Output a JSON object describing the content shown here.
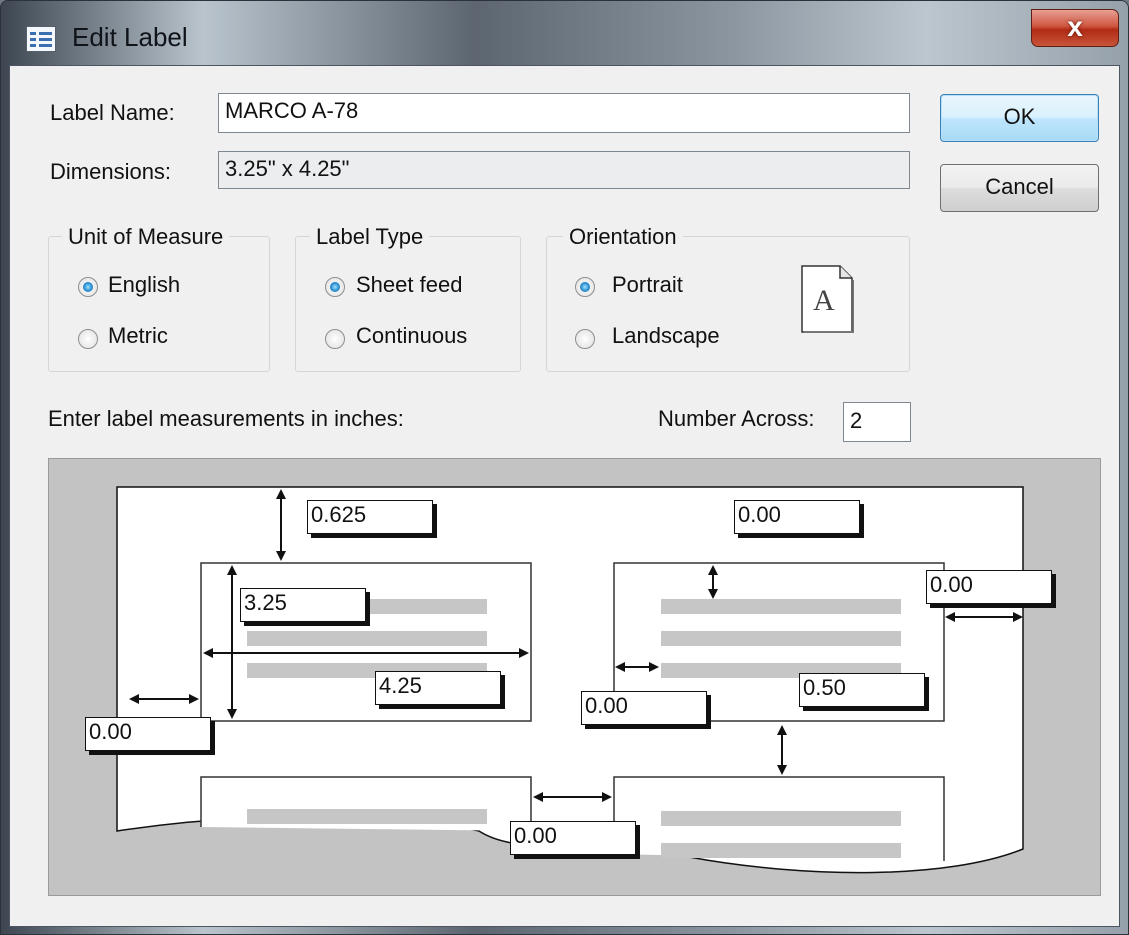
{
  "window": {
    "title": "Edit Label",
    "close_glyph": "x",
    "app_icon": "label-list-icon"
  },
  "form": {
    "label_name_label": "Label Name:",
    "label_name_value": "MARCO A-78",
    "dimensions_label": "Dimensions:",
    "dimensions_value": "3.25\" x 4.25\"",
    "measure_prompt": "Enter label measurements in inches:",
    "number_across_label": "Number Across:",
    "number_across_value": "2"
  },
  "buttons": {
    "ok": "OK",
    "cancel": "Cancel"
  },
  "unit_of_measure": {
    "title": "Unit of Measure",
    "options": [
      {
        "label": "English",
        "selected": true
      },
      {
        "label": "Metric",
        "selected": false
      }
    ]
  },
  "label_type": {
    "title": "Label Type",
    "options": [
      {
        "label": "Sheet feed",
        "selected": true
      },
      {
        "label": "Continuous",
        "selected": false
      }
    ]
  },
  "orientation": {
    "title": "Orientation",
    "options": [
      {
        "label": "Portrait",
        "selected": true
      },
      {
        "label": "Landscape",
        "selected": false
      }
    ],
    "preview_glyph": "A"
  },
  "diagram": {
    "top_margin": "0.625",
    "label_height": "3.25",
    "label_width": "4.25",
    "left_margin": "0.00",
    "top_margin_right": "0.00",
    "right_margin": "0.00",
    "inner_left": "0.00",
    "vertical_spacing": "0.50",
    "horizontal_spacing": "0.00"
  },
  "colors": {
    "selected_radio": "#2b8fd1",
    "default_button_border": "#3c7fb1",
    "close_button": "#c8553a"
  }
}
